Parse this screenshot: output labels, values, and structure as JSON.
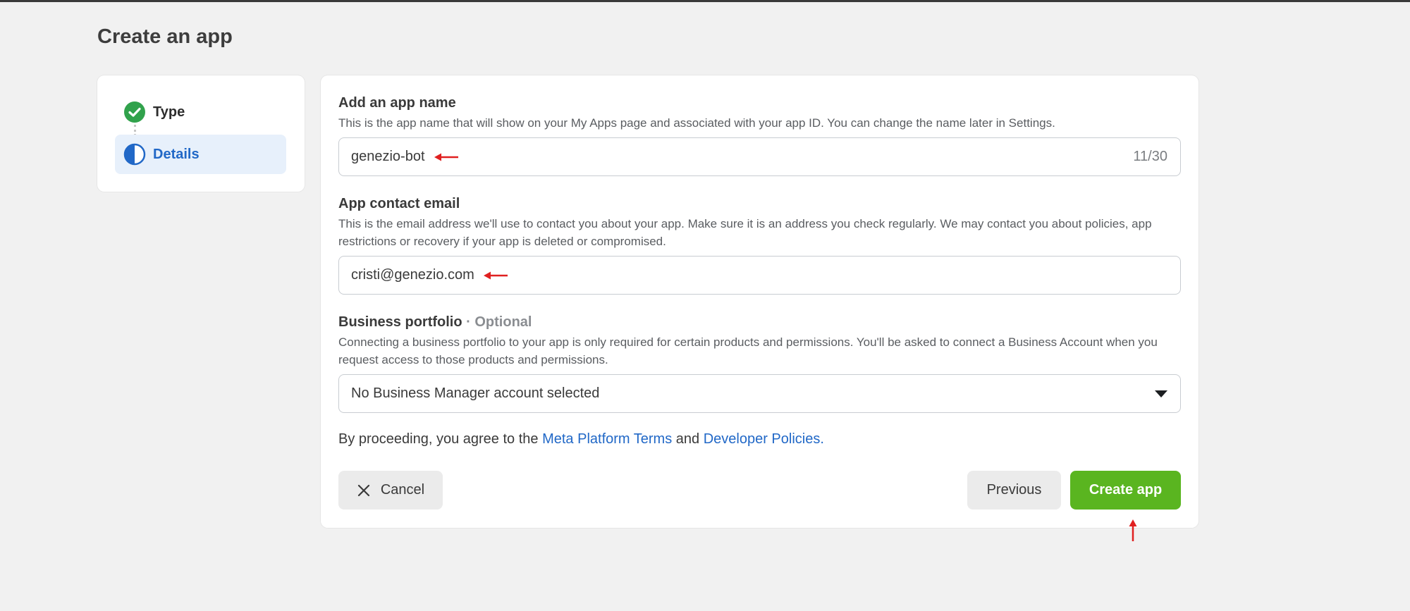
{
  "page": {
    "title": "Create an app"
  },
  "steps": [
    {
      "label": "Type",
      "status": "complete",
      "icon": "check-circle-icon"
    },
    {
      "label": "Details",
      "status": "current",
      "icon": "half-circle-icon"
    }
  ],
  "form": {
    "app_name": {
      "title": "Add an app name",
      "description": "This is the app name that will show on your My Apps page and associated with your app ID. You can change the name later in Settings.",
      "value": "genezio-bot",
      "counter": "11/30"
    },
    "contact_email": {
      "title": "App contact email",
      "description": "This is the email address we'll use to contact you about your app. Make sure it is an address you check regularly. We may contact you about policies, app restrictions or recovery if your app is deleted or compromised.",
      "value": "cristi@genezio.com"
    },
    "business_portfolio": {
      "title": "Business portfolio",
      "optional_label": "· Optional",
      "description": "Connecting a business portfolio to your app is only required for certain products and permissions. You'll be asked to connect a Business Account when you request access to those products and permissions.",
      "selected": "No Business Manager account selected"
    },
    "terms": {
      "prefix": "By proceeding, you agree to the ",
      "link1": "Meta Platform Terms",
      "middle": " and ",
      "link2": "Developer Policies."
    }
  },
  "buttons": {
    "cancel": "Cancel",
    "previous": "Previous",
    "create": "Create app"
  },
  "colors": {
    "accent_blue": "#2168c7",
    "success_green": "#5ab520",
    "annotation_red": "#e02020"
  }
}
